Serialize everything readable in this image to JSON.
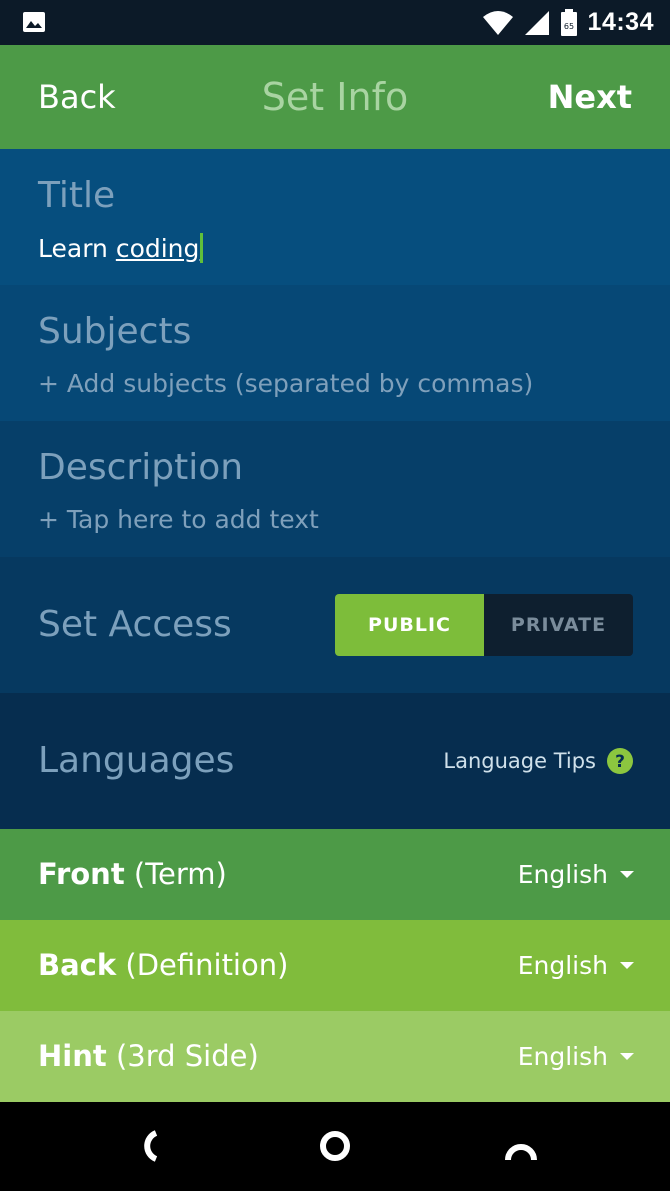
{
  "status_bar": {
    "time": "14:34",
    "battery": "65",
    "icons": [
      "photo-icon",
      "wifi-icon",
      "signal-icon",
      "battery-icon"
    ]
  },
  "app_bar": {
    "back_label": "Back",
    "title": "Set Info",
    "next_label": "Next"
  },
  "title_field": {
    "label": "Title",
    "value_plain": "Learn ",
    "value_underlined": "coding"
  },
  "subjects_field": {
    "label": "Subjects",
    "placeholder": "+ Add subjects (separated by commas)"
  },
  "description_field": {
    "label": "Description",
    "placeholder": "+ Tap here to add text"
  },
  "set_access": {
    "label": "Set Access",
    "options": [
      "PUBLIC",
      "PRIVATE"
    ],
    "selected": "PUBLIC"
  },
  "languages": {
    "label": "Languages",
    "tips_label": "Language Tips"
  },
  "sides": [
    {
      "name": "Front",
      "qualifier": "(Term)",
      "language": "English",
      "color": "#4d9a47"
    },
    {
      "name": "Back",
      "qualifier": "(Definition)",
      "language": "English",
      "color": "#80bc3c"
    },
    {
      "name": "Hint",
      "qualifier": "(3rd Side)",
      "language": "English",
      "color": "#9bcb64"
    }
  ],
  "colors": {
    "accent_green": "#4d9a47",
    "toggle_active": "#7dbd3a",
    "navy": "#063960"
  },
  "nav_bar": {
    "icons": [
      "back-nav-icon",
      "home-nav-icon",
      "recents-nav-icon"
    ]
  }
}
